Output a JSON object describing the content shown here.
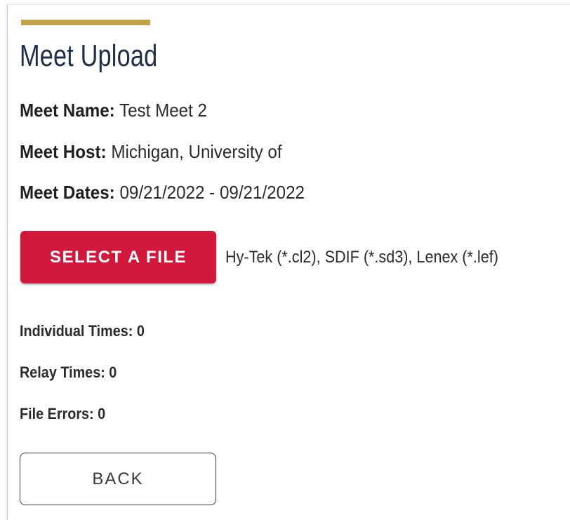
{
  "page": {
    "title": "Meet Upload",
    "accent_color": "#c4a24b"
  },
  "meet": {
    "name_label": "Meet Name:",
    "name_value": " Test Meet 2",
    "host_label": "Meet Host:",
    "host_value": " Michigan, University of",
    "dates_label": "Meet Dates:",
    "dates_value": " 09/21/2022 - 09/21/2022"
  },
  "upload": {
    "select_label": "SELECT A FILE",
    "select_color": "#d2193d",
    "file_types": "Hy-Tek (*.cl2), SDIF (*.sd3), Lenex (*.lef)"
  },
  "stats": {
    "individual_times": "Individual Times: 0",
    "relay_times": "Relay Times: 0",
    "file_errors": "File Errors: 0"
  },
  "actions": {
    "back_label": "BACK"
  }
}
